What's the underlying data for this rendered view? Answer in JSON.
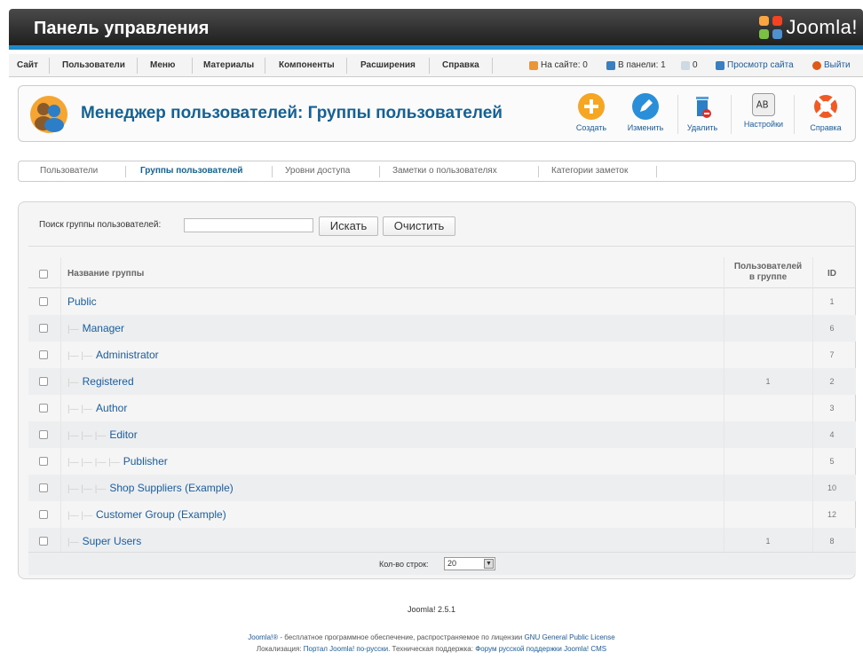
{
  "header": {
    "title": "Панель управления",
    "logo_text": "Joomla!"
  },
  "menu": {
    "items": [
      "Сайт",
      "Пользователи",
      "Меню",
      "Материалы",
      "Компоненты",
      "Расширения",
      "Справка"
    ]
  },
  "status": {
    "on_site": "На сайте: 0",
    "in_panel": "В панели: 1",
    "messages": "0",
    "view_site": "Просмотр сайта",
    "logout": "Выйти"
  },
  "toolbar": {
    "page_title": "Менеджер пользователей: Группы пользователей",
    "create": "Создать",
    "edit": "Изменить",
    "delete": "Удалить",
    "settings": "Настройки",
    "help": "Справка"
  },
  "tabs": [
    "Пользователи",
    "Группы пользователей",
    "Уровни доступа",
    "Заметки о пользователях",
    "Категории заметок"
  ],
  "search": {
    "label": "Поиск группы пользователей:",
    "value": "",
    "search_button": "Искать",
    "clear_button": "Очистить"
  },
  "table": {
    "headers": {
      "name": "Название группы",
      "users_line1": "Пользователей",
      "users_line2": "в группе",
      "id": "ID"
    },
    "rows": [
      {
        "name": "Public",
        "level": 0,
        "users": "",
        "id": "1"
      },
      {
        "name": "Manager",
        "level": 1,
        "users": "",
        "id": "6"
      },
      {
        "name": "Administrator",
        "level": 2,
        "users": "",
        "id": "7"
      },
      {
        "name": "Registered",
        "level": 1,
        "users": "1",
        "id": "2"
      },
      {
        "name": "Author",
        "level": 2,
        "users": "",
        "id": "3"
      },
      {
        "name": "Editor",
        "level": 3,
        "users": "",
        "id": "4"
      },
      {
        "name": "Publisher",
        "level": 4,
        "users": "",
        "id": "5"
      },
      {
        "name": "Shop Suppliers (Example)",
        "level": 3,
        "users": "",
        "id": "10"
      },
      {
        "name": "Customer Group (Example)",
        "level": 2,
        "users": "",
        "id": "12"
      },
      {
        "name": "Super Users",
        "level": 1,
        "users": "1",
        "id": "8"
      }
    ]
  },
  "pager": {
    "label": "Кол-во строк:",
    "value": "20"
  },
  "footer": {
    "version": "Joomla! 2.5.1",
    "line1_link": "Joomla!®",
    "line1_text": " - бесплатное программное обеспечение, распространяемое по лицензии ",
    "line1_license": "GNU General Public License",
    "line2_prefix": "Локализация: ",
    "line2_link1": "Портал Joomla! по-русски",
    "line2_mid": ". Техническая поддержка: ",
    "line2_link2": "Форум русской поддержки Joomla! CMS"
  },
  "colors": {
    "accent_blue": "#1e88c8",
    "link_blue": "#1b5c9e",
    "title_blue": "#146295"
  }
}
